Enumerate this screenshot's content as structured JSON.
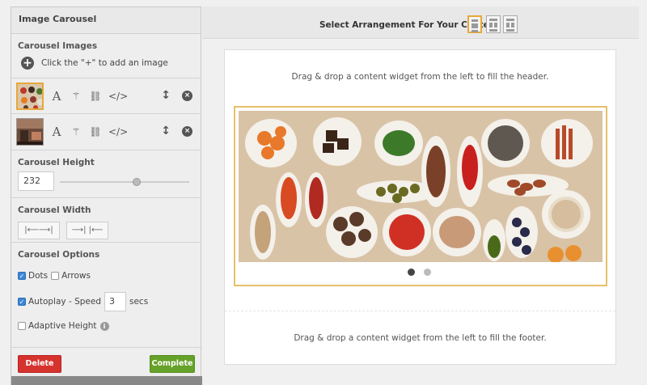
{
  "panel": {
    "title": "Image Carousel",
    "images_heading": "Carousel Images",
    "add_hint": "Click the \"+\" to add an image",
    "height_heading": "Carousel Height",
    "height_value": "232",
    "height_slider_fraction": 0.6,
    "width_heading": "Carousel Width",
    "width_expand_label": "|⟵⟶|",
    "width_shrink_label": "⟶| |⟵",
    "options_heading": "Carousel Options",
    "opt_dots": "Dots",
    "opt_arrows": "Arrows",
    "opt_autoplay": "Autoplay - Speed",
    "speed_value": "3",
    "speed_unit": "secs",
    "opt_adaptive": "Adaptive Height",
    "delete_label": "Delete",
    "complete_label": "Complete"
  },
  "toolbar_icons": {
    "text": "A",
    "code": "</>"
  },
  "topbar": {
    "label": "Select Arrangement For Your Content"
  },
  "canvas": {
    "header_hint": "Drag & drop a content widget from the left to fill the header.",
    "footer_hint": "Drag & drop a content widget from the left to fill the footer."
  },
  "colors": {
    "accent": "#e6a83a",
    "delete": "#d6332f",
    "complete": "#66a22a",
    "checkbox": "#3b86d6"
  }
}
